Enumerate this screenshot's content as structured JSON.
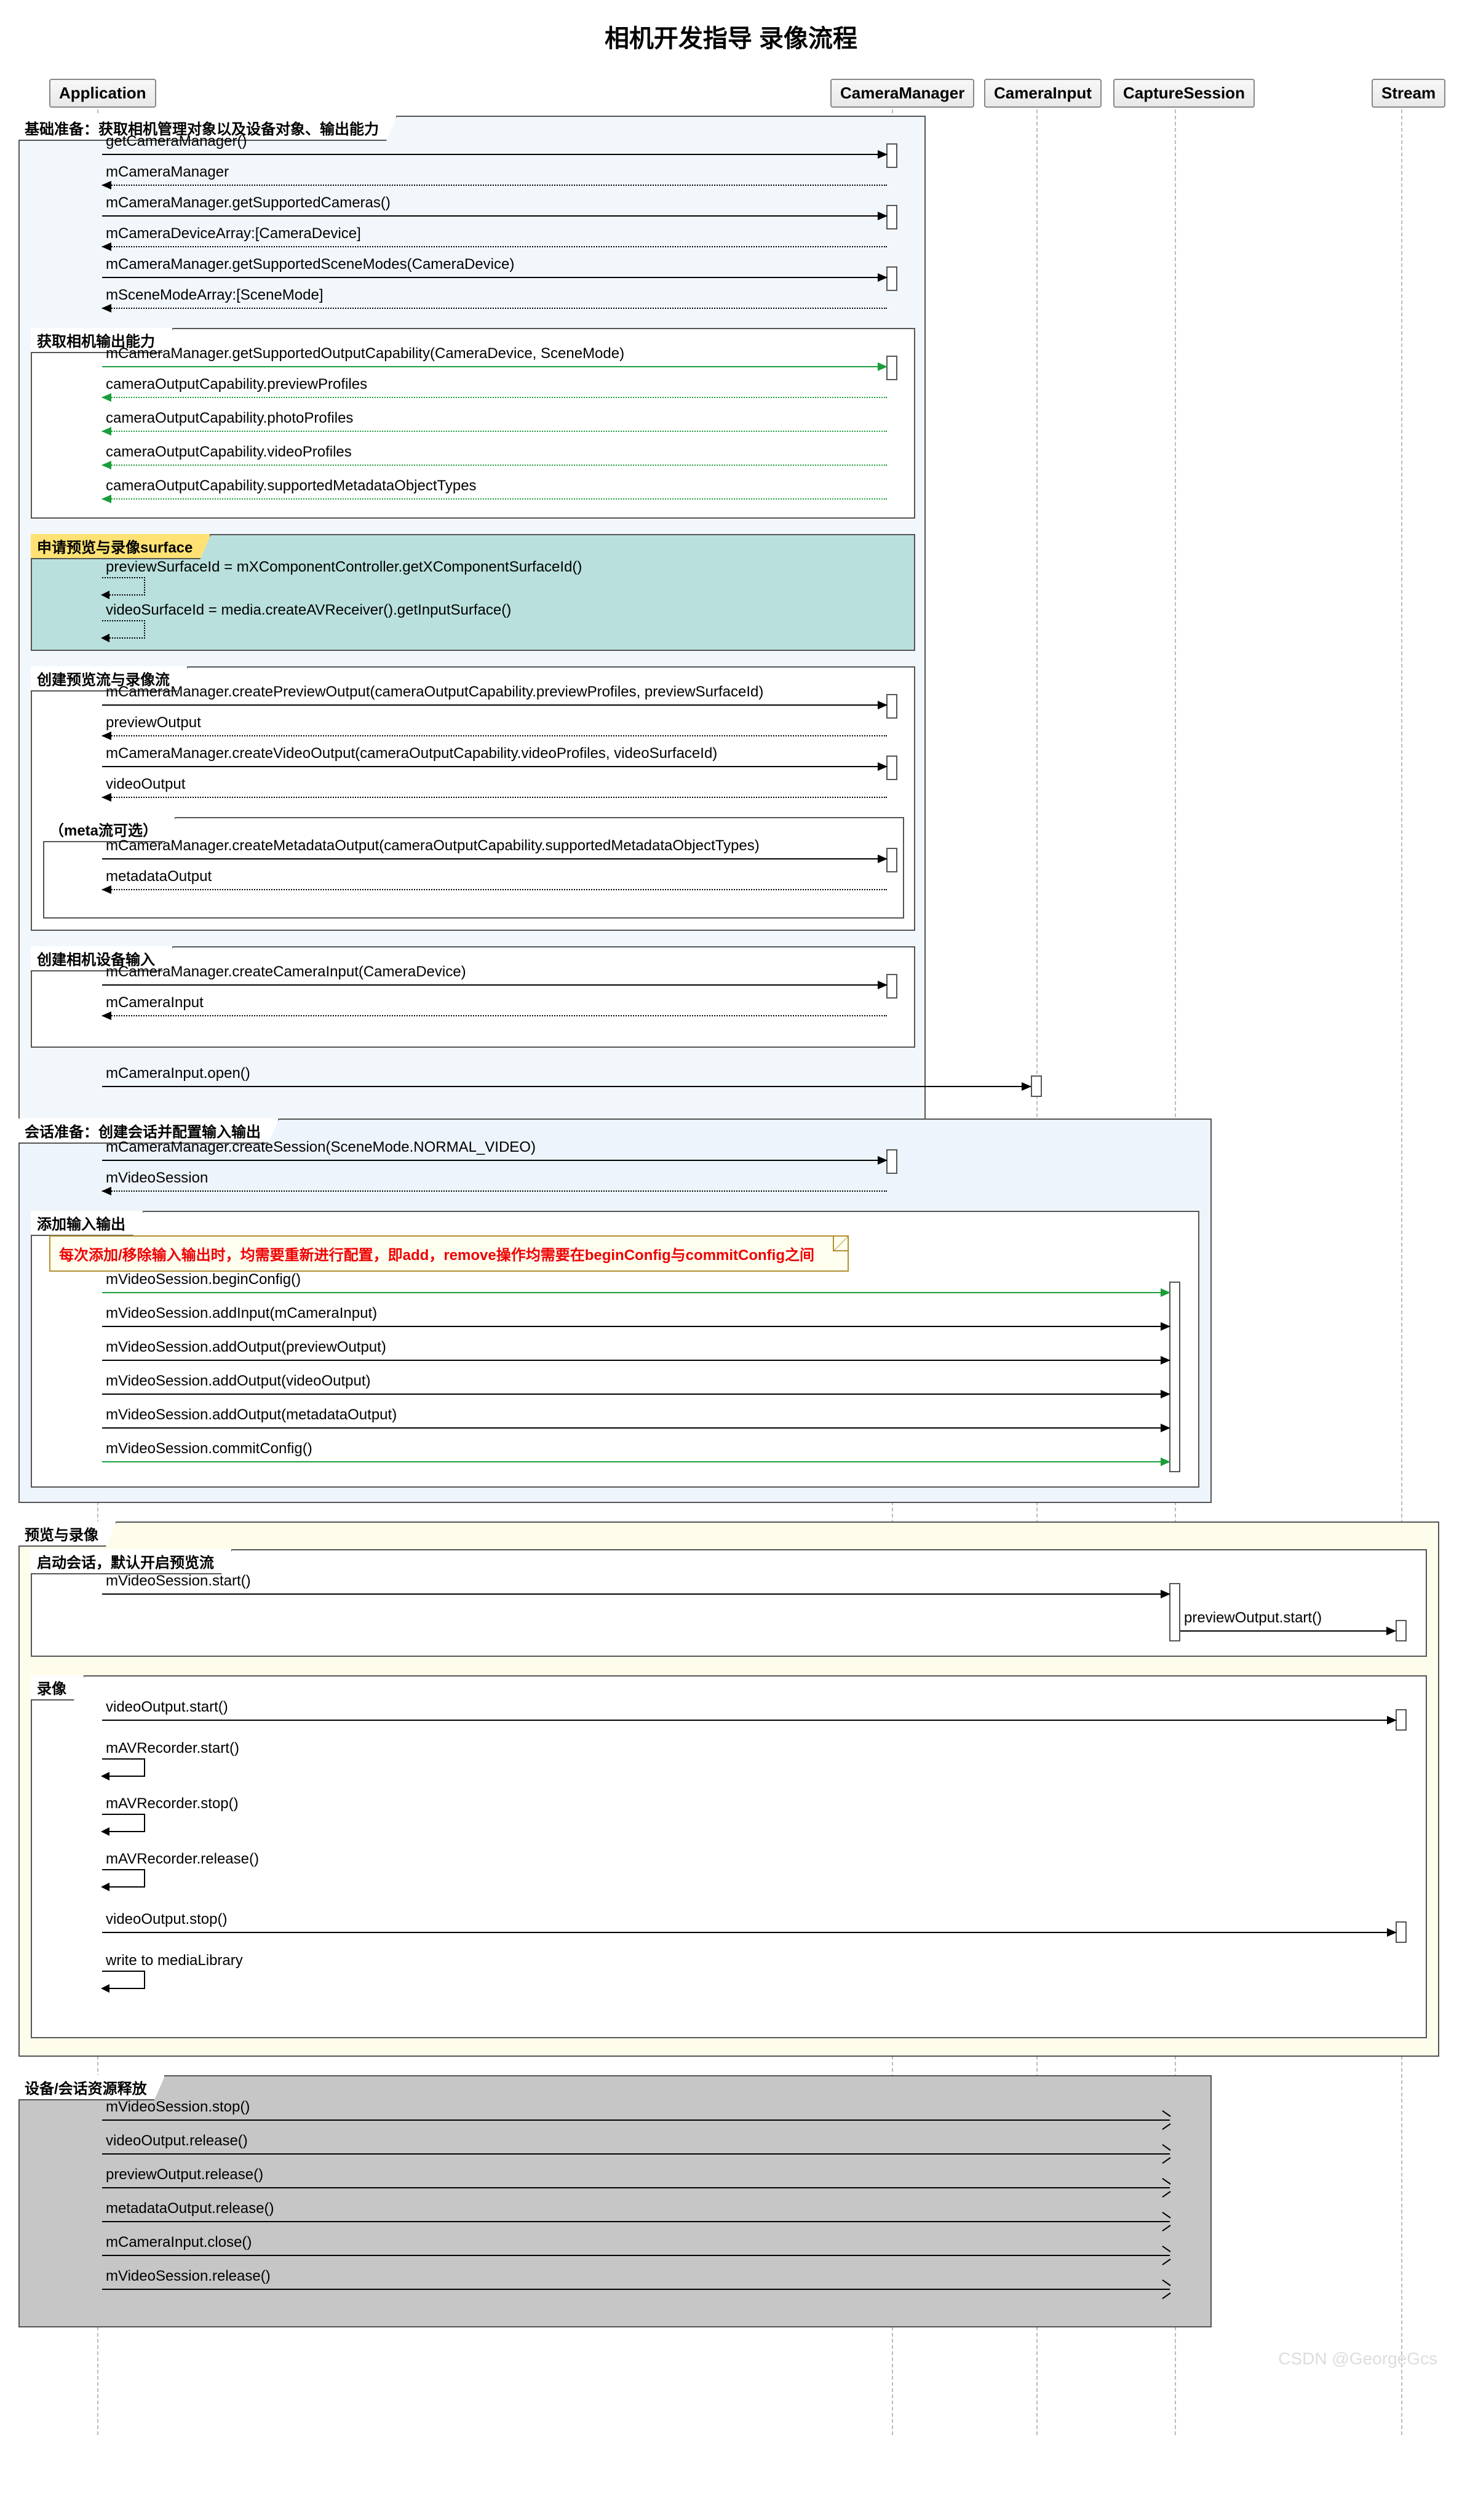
{
  "title": "相机开发指导 录像流程",
  "participants": {
    "app": "Application",
    "cm": "CameraManager",
    "ci": "CameraInput",
    "cs": "CaptureSession",
    "st": "Stream"
  },
  "frames": {
    "f1": "基础准备：获取相机管理对象以及设备对象、输出能力",
    "f2": "获取相机输出能力",
    "f3": "申请预览与录像surface",
    "f4": "创建预览流与录像流",
    "f4a": "（meta流可选）",
    "f5": "创建相机设备输入",
    "f6": "会话准备：创建会话并配置输入输出",
    "f7": "添加输入输出",
    "f8": "预览与录像",
    "f9": "启动会话，默认开启预览流",
    "f10": "录像",
    "f11": "设备/会话资源释放"
  },
  "note1": "每次添加/移除输入输出时，均需要重新进行配置，即add，remove操作均需要在beginConfig与commitConfig之间",
  "msgs": {
    "m1": "getCameraManager()",
    "m2": "mCameraManager",
    "m3": "mCameraManager.getSupportedCameras()",
    "m4": "mCameraDeviceArray:[CameraDevice]",
    "m5": "mCameraManager.getSupportedSceneModes(CameraDevice)",
    "m6": "mSceneModeArray:[SceneMode]",
    "m7": "mCameraManager.getSupportedOutputCapability(CameraDevice, SceneMode)",
    "m8": "cameraOutputCapability.previewProfiles",
    "m9": "cameraOutputCapability.photoProfiles",
    "m10": "cameraOutputCapability.videoProfiles",
    "m11": "cameraOutputCapability.supportedMetadataObjectTypes",
    "m12": "previewSurfaceId = mXComponentController.getXComponentSurfaceId()",
    "m13": "videoSurfaceId = media.createAVReceiver().getInputSurface()",
    "m14": "mCameraManager.createPreviewOutput(cameraOutputCapability.previewProfiles, previewSurfaceId)",
    "m15": "previewOutput",
    "m16": "mCameraManager.createVideoOutput(cameraOutputCapability.videoProfiles, videoSurfaceId)",
    "m17": "videoOutput",
    "m18": "mCameraManager.createMetadataOutput(cameraOutputCapability.supportedMetadataObjectTypes)",
    "m19": "metadataOutput",
    "m20": "mCameraManager.createCameraInput(CameraDevice)",
    "m21": "mCameraInput",
    "m22": "mCameraInput.open()",
    "m23": "mCameraManager.createSession(SceneMode.NORMAL_VIDEO)",
    "m24": "mVideoSession",
    "m25": "mVideoSession.beginConfig()",
    "m26": "mVideoSession.addInput(mCameraInput)",
    "m27": "mVideoSession.addOutput(previewOutput)",
    "m28": "mVideoSession.addOutput(videoOutput)",
    "m29": "mVideoSession.addOutput(metadataOutput)",
    "m30": "mVideoSession.commitConfig()",
    "m31": "mVideoSession.start()",
    "m32": "previewOutput.start()",
    "m33": "videoOutput.start()",
    "m34": "mAVRecorder.start()",
    "m35": "mAVRecorder.stop()",
    "m36": "mAVRecorder.release()",
    "m37": "videoOutput.stop()",
    "m38": "write to mediaLibrary",
    "m39": "mVideoSession.stop()",
    "m40": "videoOutput.release()",
    "m41": "previewOutput.release()",
    "m42": "metadataOutput.release()",
    "m43": "mCameraInput.close()",
    "m44": "mVideoSession.release()"
  },
  "watermark": "CSDN @GeorgeGcs"
}
